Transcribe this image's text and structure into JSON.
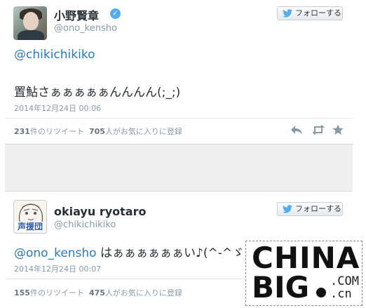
{
  "tweets": [
    {
      "name": "小野賢章",
      "handle": "@ono_kensho",
      "verified": true,
      "follow_label": "フォローする",
      "mention": "@chikichikiko",
      "text": "置鮎さぁぁぁぁぁんんんん(;_;)",
      "timestamp": "2014年12月24日 00:06",
      "retweet_count": "231",
      "retweet_label": "件のリツイート",
      "favorite_count": "705",
      "favorite_label": "人がお気に入りに登録"
    },
    {
      "name": "okiayu ryotaro",
      "handle": "@chikichikiko",
      "verified": false,
      "avatar_text": "声援団",
      "follow_label": "フォローする",
      "mention": "@ono_kensho",
      "text": " はぁぁぁぁぁぁい♪(^-^ゞ",
      "timestamp": "2014年12月24日 00:07",
      "retweet_count": "155",
      "retweet_label": "件のリツイート",
      "favorite_count": "475",
      "favorite_label": "人がお気に入りに登録"
    }
  ],
  "watermark": {
    "line1": "CHINA",
    "line2": "BIG",
    "suffix": ".COM .cn"
  },
  "icons": [
    "twitter-bird-icon",
    "verified-badge-icon",
    "reply-icon",
    "retweet-icon",
    "favorite-icon"
  ],
  "colors": {
    "link": "#2b7bb9",
    "verified": "#55acee",
    "twitter_blue": "#55acee"
  }
}
